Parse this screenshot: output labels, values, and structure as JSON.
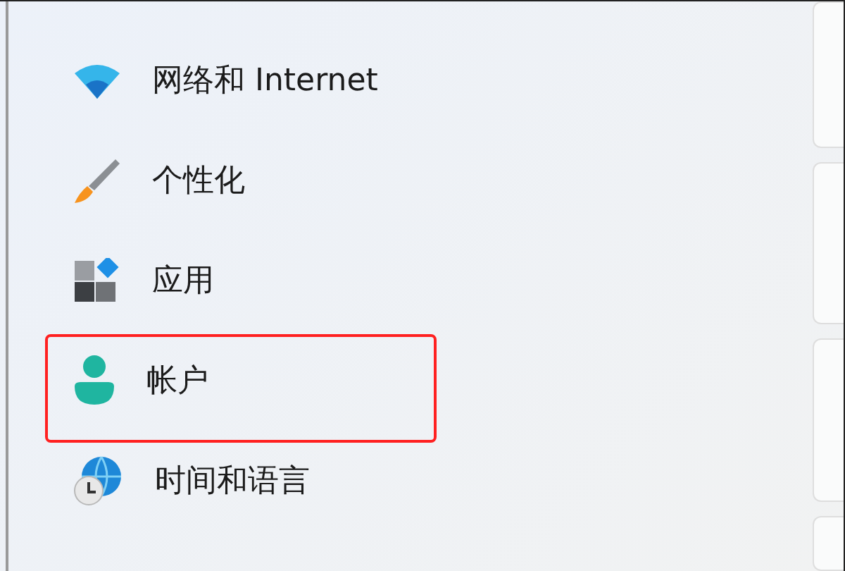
{
  "sidebar": {
    "items": [
      {
        "kind": "network",
        "label": "网络和 Internet",
        "highlighted": false
      },
      {
        "kind": "personalize",
        "label": "个性化",
        "highlighted": false
      },
      {
        "kind": "apps",
        "label": "应用",
        "highlighted": false
      },
      {
        "kind": "accounts",
        "label": "帐户",
        "highlighted": true
      },
      {
        "kind": "time",
        "label": "时间和语言",
        "highlighted": false
      }
    ]
  }
}
